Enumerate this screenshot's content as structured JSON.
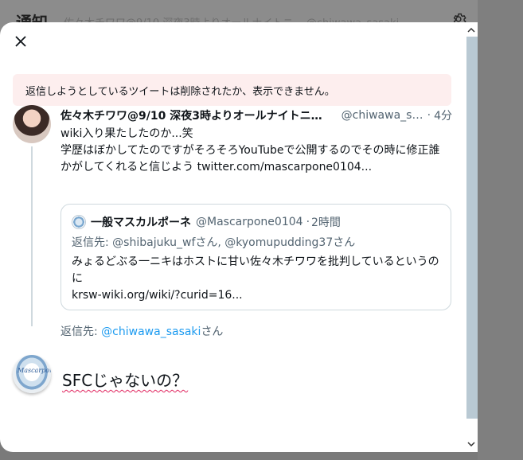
{
  "background": {
    "title": "通知",
    "tabs_text": "佐々木チワワ@9/10 深夜3時よりオールナイトニ... @chiwawa_sasaki",
    "gear_icon": "gear-icon"
  },
  "modal": {
    "close_icon": "close-icon",
    "alert": "返信しようとしているツイートは削除されたか、表示できません。",
    "tweet": {
      "author_name": "佐々木チワワ@9/10 深夜3時よりオールナイトニッ...",
      "author_handle": "@chiwawa_sa...",
      "dot": "·",
      "time": "4分",
      "lines": [
        "wiki入り果たしたのか...笑",
        "学歴はぼかしてたのですがそろそろYouTubeで公開するのでその時に修正誰",
        "かがしてくれると信じよう twitter.com/mascarpone0104..."
      ]
    },
    "quote": {
      "name": "一般マスカルポーネ",
      "handle": "@Mascarpone0104",
      "dot": "·",
      "time": "2時間",
      "replying_to": "返信先: @shibajuku_wfさん, @kyomupudding37さん",
      "lines": [
        "みょるどぶる一ニキはホストに甘い佐々木チワワを批判しているというの",
        "に",
        "krsw-wiki.org/wiki/?curid=16..."
      ]
    },
    "replying_to": {
      "prefix": "返信先: ",
      "handle": "@chiwawa_sasaki",
      "suffix": "さん"
    },
    "compose": {
      "text": "SFCじゃないの？",
      "avatar_label": "Mascarpone"
    }
  },
  "colors": {
    "accent": "#1d9bf0",
    "alert_bg": "#fdeeee",
    "secondary_text": "#536471",
    "scroll_thumb": "#b9c9d3"
  }
}
